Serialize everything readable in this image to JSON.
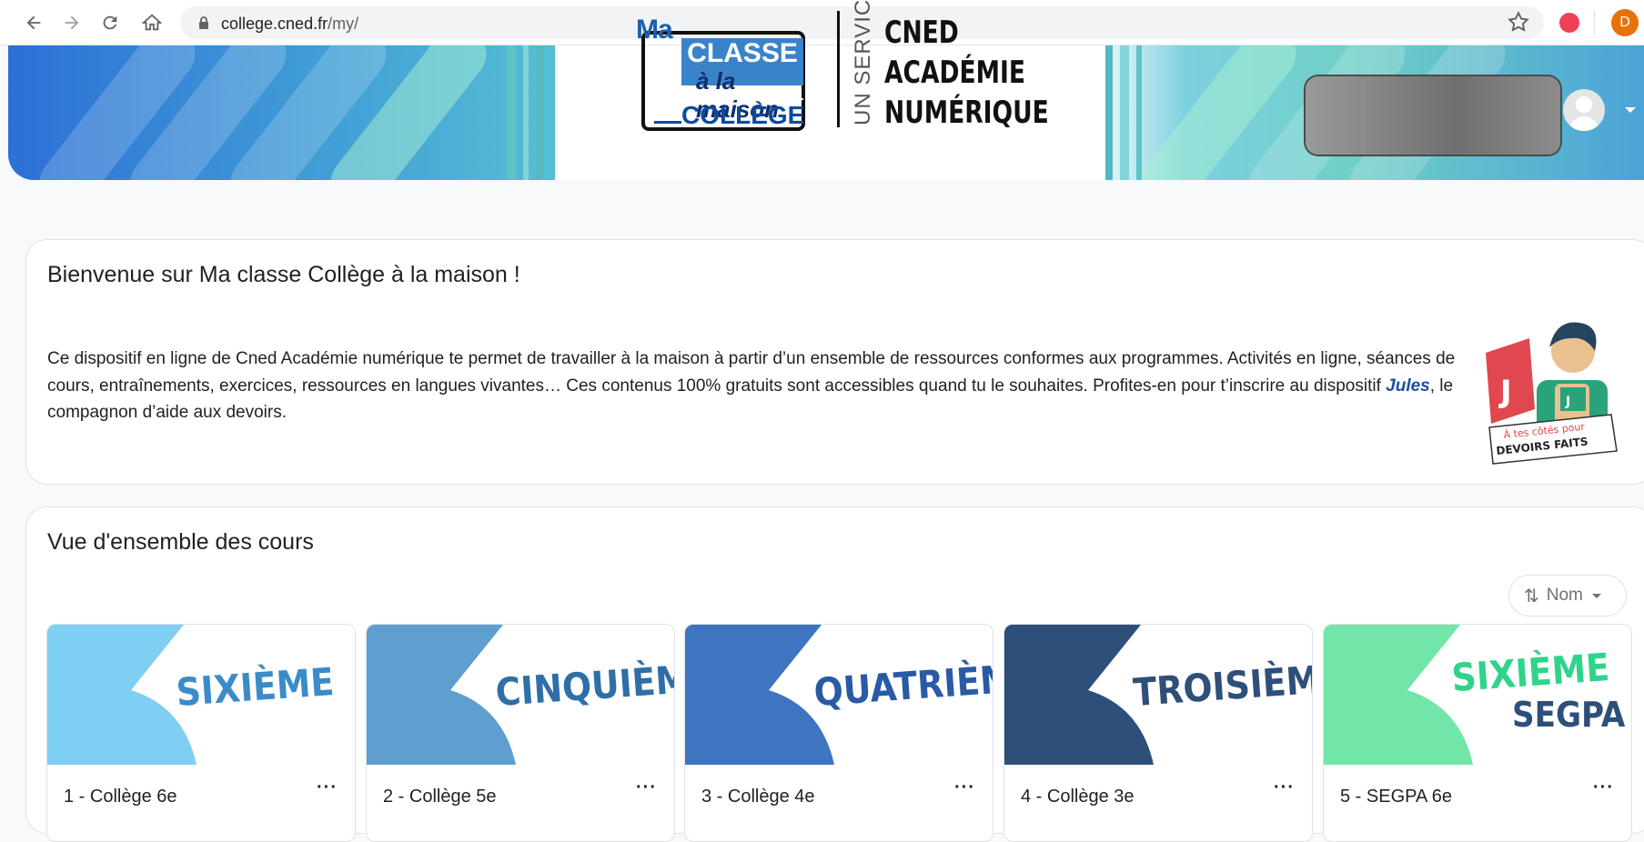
{
  "browser": {
    "url_host": "college.cned.fr",
    "url_path": "/my/",
    "profile_initial": "D",
    "icons": [
      "back-icon",
      "forward-icon",
      "reload-icon",
      "home-icon",
      "lock-icon",
      "star-icon",
      "pocket-icon"
    ]
  },
  "banner": {
    "logo_ma": "Ma",
    "logo_classe": "CLASSE",
    "logo_maison": "à la maison",
    "logo_college": "COLLÈGE",
    "service": "UN SERVICE",
    "cned_line1": "CNED",
    "cned_line2": "ACADÉMIE",
    "cned_line3": "NUMÉRIQUE"
  },
  "welcome": {
    "title": "Bienvenue sur Ma classe Collège à la maison !",
    "text_before": "Ce dispositif en ligne de Cned Académie numérique te permet de travailler à la maison à partir d’un ensemble de ressources conformes aux programmes. Activités en ligne, séances de cours, entraînements, exercices, ressources en langues vivantes… Ces contenus 100% gratuits sont accessibles quand tu le souhaites. Profites-en pour t’inscrire au dispositif ",
    "link": "Jules",
    "text_after": ", le compagnon d’aide aux devoirs.",
    "badge_line1": "À tes côtés pour",
    "badge_line2": "DEVOIRS FAITS",
    "badge_letter": "J"
  },
  "overview": {
    "title": "Vue d'ensemble des cours",
    "sort_label": "Nom",
    "courses": [
      {
        "label": "1 - Collège 6e",
        "banner": "SIXIÈME",
        "banner2": "",
        "color": "#7ecff2",
        "text_color": "#3a8cc8",
        "menu": "···"
      },
      {
        "label": "2 - Collège 5e",
        "banner": "CINQUIÈM",
        "banner2": "",
        "color": "#5e9fcf",
        "text_color": "#2f6fa8",
        "menu": "···"
      },
      {
        "label": "3 - Collège 4e",
        "banner": "QUATRIÈM",
        "banner2": "",
        "color": "#3e74c0",
        "text_color": "#2a5aa6",
        "menu": "···"
      },
      {
        "label": "4 - Collège 3e",
        "banner": "TROISIÈM",
        "banner2": "",
        "color": "#2e4f79",
        "text_color": "#2e4f79",
        "menu": "···"
      },
      {
        "label": "5 - SEGPA 6e",
        "banner": "SIXIÈME",
        "banner2": "SEGPA",
        "color": "#72e6a8",
        "text_color": "#2fd48a",
        "menu": "···"
      }
    ]
  }
}
